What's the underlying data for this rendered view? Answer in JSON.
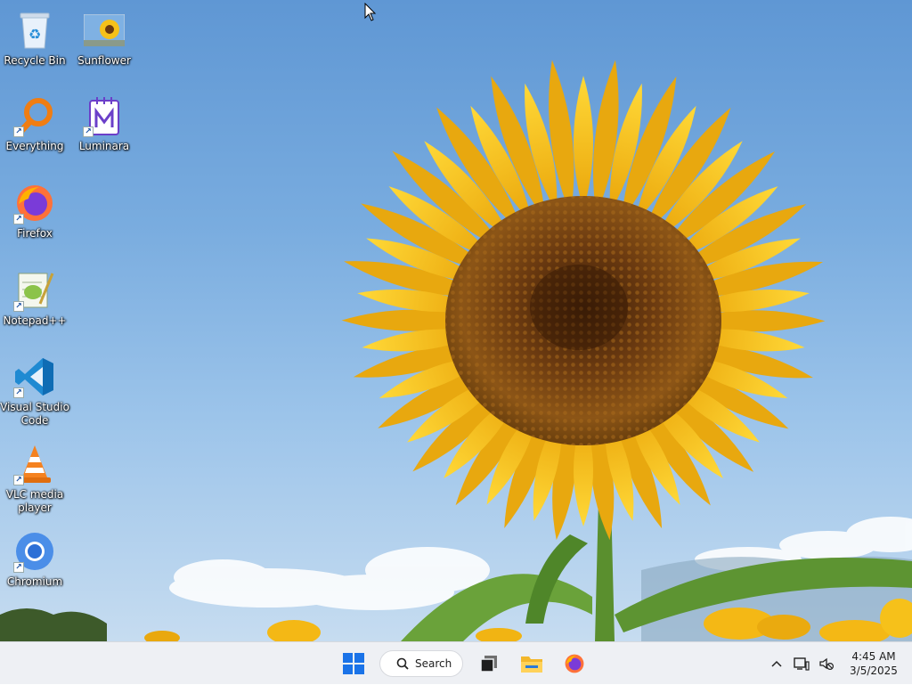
{
  "desktop": {
    "icons": [
      {
        "id": "recycle-bin",
        "label": "Recycle Bin"
      },
      {
        "id": "sunflower",
        "label": "Sunflower"
      },
      {
        "id": "everything",
        "label": "Everything"
      },
      {
        "id": "luminara",
        "label": "Luminara"
      },
      {
        "id": "firefox",
        "label": "Firefox"
      },
      {
        "id": "notepadpp",
        "label": "Notepad++"
      },
      {
        "id": "vscode",
        "label": "Visual Studio Code"
      },
      {
        "id": "vlc",
        "label": "VLC media player"
      },
      {
        "id": "chromium",
        "label": "Chromium"
      }
    ]
  },
  "taskbar": {
    "search_label": "Search",
    "pinned": [
      "start-icon",
      "task-view-icon",
      "file-explorer-icon",
      "firefox-icon"
    ],
    "clock": {
      "time": "4:45 AM",
      "date": "3/5/2025"
    }
  },
  "colors": {
    "taskbar": "#eef0f4",
    "sky": "#79acdf",
    "petal": "#f6c11a",
    "disk": "#7a4411",
    "stem": "#5a8f2e",
    "accent": "#0a64d6"
  }
}
